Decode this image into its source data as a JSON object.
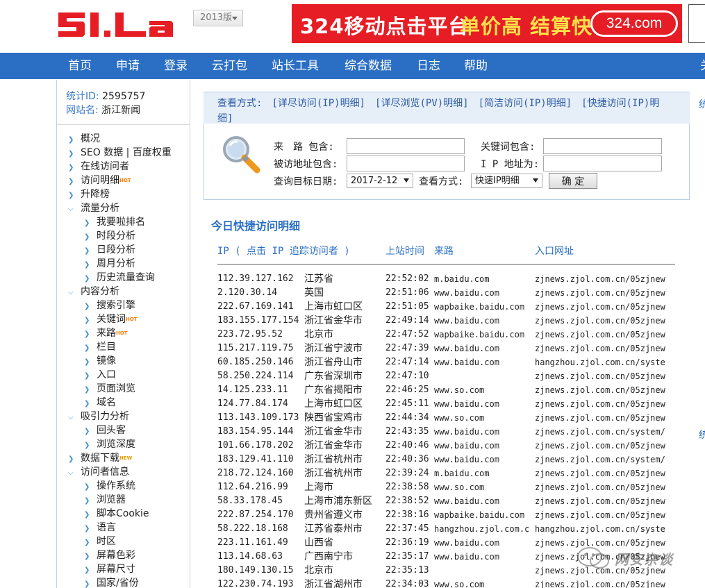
{
  "header": {
    "logo_text": "51.La",
    "version_label": "2013版",
    "ad": {
      "text_main": "324移动点击平台",
      "text_highlight": "单价高 结算快",
      "pill": "324.com"
    }
  },
  "nav": {
    "items": [
      "首页",
      "申请",
      "登录",
      "云打包",
      "站长工具",
      "综合数据",
      "日志",
      "帮助"
    ],
    "edge_fragment": "关"
  },
  "site_info": {
    "id_label": "统计ID:",
    "id_value": "2595757",
    "name_label": "网站名:",
    "name_value": "浙江新闻"
  },
  "sidebar": {
    "overview": "概况",
    "seo": "SEO 数据 | 百度权重",
    "online": "在线访问者",
    "visit_detail": "访问明细",
    "rank": "升降榜",
    "traffic": "流量分析",
    "traffic_children": [
      "我要啦排名",
      "时段分析",
      "日段分析",
      "周月分析",
      "历史流量查询"
    ],
    "content": "内容分析",
    "content_children": [
      "搜索引擎",
      "关键词",
      "来路",
      "栏目",
      "镜像",
      "入口",
      "页面浏览",
      "域名"
    ],
    "attract": "吸引力分析",
    "attract_children": [
      "回头客",
      "浏览深度"
    ],
    "download": "数据下载",
    "visitor": "访问者信息",
    "visitor_children": [
      "操作系统",
      "浏览器",
      "脚本Cookie",
      "语言",
      "时区",
      "屏幕色彩",
      "屏幕尺寸",
      "国家/省份"
    ],
    "badge_hot": "HOT",
    "badge_new": "NEW"
  },
  "viewbar": {
    "label": "查看方式:",
    "options": [
      "[详尽访问(IP)明细]",
      "[详尽浏览(PV)明细]",
      "[简洁访问(IP)明细]",
      "[快捷访问(IP)明细]"
    ]
  },
  "query": {
    "referrer_label": "来　路 包含:",
    "keyword_label": "关键词包含:",
    "visited_label": "被访地址包含:",
    "ip_label": "I P 地址为:",
    "date_label": "查询目标日期:",
    "date_value": "2017-2-12",
    "mode_label": "查看方式:",
    "mode_value": "快速IP明细",
    "confirm": "确 定"
  },
  "table": {
    "title": "今日快捷访问明细",
    "headers": {
      "ip": "IP ( 点击 IP 追踪访问者 )",
      "time": "上站时间",
      "referrer": "来路",
      "entry": "入口网址"
    },
    "rows": [
      {
        "ip": "112.39.127.162",
        "region": "江苏省",
        "time": "22:52:02",
        "referrer": "m.baidu.com",
        "entry": "zjnews.zjol.com.cn/05zjnew"
      },
      {
        "ip": "2.120.30.14",
        "region": "英国",
        "time": "22:51:06",
        "referrer": "www.baidu.com",
        "entry": "zjnews.zjol.com.cn/05zjnew"
      },
      {
        "ip": "222.67.169.141",
        "region": "上海市虹口区",
        "time": "22:51:05",
        "referrer": "wapbaike.baidu.com",
        "entry": "zjnews.zjol.com.cn/05zjnew"
      },
      {
        "ip": "183.155.177.154",
        "region": "浙江省金华市",
        "time": "22:49:14",
        "referrer": "www.baidu.com",
        "entry": "zjnews.zjol.com.cn/05zjnew"
      },
      {
        "ip": "223.72.95.52",
        "region": "北京市",
        "time": "22:47:52",
        "referrer": "wapbaike.baidu.com",
        "entry": "zjnews.zjol.com.cn/05zjnew"
      },
      {
        "ip": "115.217.119.75",
        "region": "浙江省宁波市",
        "time": "22:47:39",
        "referrer": "www.baidu.com",
        "entry": "zjnews.zjol.com.cn/05zjnew"
      },
      {
        "ip": "60.185.250.146",
        "region": "浙江省舟山市",
        "time": "22:47:14",
        "referrer": "www.baidu.com",
        "entry": "hangzhou.zjol.com.cn/syste"
      },
      {
        "ip": "58.250.224.114",
        "region": "广东省深圳市",
        "time": "22:47:10",
        "referrer": "",
        "entry": "zjnews.zjol.com.cn/05zjnew"
      },
      {
        "ip": "14.125.233.11",
        "region": "广东省揭阳市",
        "time": "22:46:25",
        "referrer": "www.so.com",
        "entry": "zjnews.zjol.com.cn/05zjnew"
      },
      {
        "ip": "124.77.84.174",
        "region": "上海市虹口区",
        "time": "22:45:11",
        "referrer": "www.baidu.com",
        "entry": "zjnews.zjol.com.cn/05zjnew"
      },
      {
        "ip": "113.143.109.173",
        "region": "陕西省宝鸡市",
        "time": "22:44:34",
        "referrer": "www.so.com",
        "entry": "zjnews.zjol.com.cn/05zjnew"
      },
      {
        "ip": "183.154.95.144",
        "region": "浙江省金华市",
        "time": "22:43:35",
        "referrer": "www.baidu.com",
        "entry": "zjnews.zjol.com.cn/system/"
      },
      {
        "ip": "101.66.178.202",
        "region": "浙江省金华市",
        "time": "22:40:46",
        "referrer": "www.baidu.com",
        "entry": "zjnews.zjol.com.cn/05zjnew"
      },
      {
        "ip": "183.129.41.110",
        "region": "浙江省杭州市",
        "time": "22:40:36",
        "referrer": "www.baidu.com",
        "entry": "zjnews.zjol.com.cn/system/"
      },
      {
        "ip": "218.72.124.160",
        "region": "浙江省杭州市",
        "time": "22:39:24",
        "referrer": "m.baidu.com",
        "entry": "zjnews.zjol.com.cn/05zjnew"
      },
      {
        "ip": "112.64.216.99",
        "region": "上海市",
        "time": "22:38:58",
        "referrer": "www.so.com",
        "entry": "zjnews.zjol.com.cn/05zjnew"
      },
      {
        "ip": "58.33.178.45",
        "region": "上海市浦东新区",
        "time": "22:38:52",
        "referrer": "www.baidu.com",
        "entry": "zjnews.zjol.com.cn/05zjnew"
      },
      {
        "ip": "222.87.254.170",
        "region": "贵州省遵义市",
        "time": "22:38:16",
        "referrer": "wapbaike.baidu.com",
        "entry": "zjnews.zjol.com.cn/05zjnew"
      },
      {
        "ip": "58.222.18.168",
        "region": "江苏省泰州市",
        "time": "22:37:45",
        "referrer": "hangzhou.zjol.com.c",
        "entry": "hangzhou.zjol.com.cn/syste"
      },
      {
        "ip": "223.11.161.49",
        "region": "山西省",
        "time": "22:36:19",
        "referrer": "www.baidu.com",
        "entry": "zjnews.zjol.com.cn/05zjnew"
      },
      {
        "ip": "113.14.68.63",
        "region": "广西南宁市",
        "time": "22:35:17",
        "referrer": "www.baidu.com",
        "entry": "zjnews.zjol.com.cn/05zjnew"
      },
      {
        "ip": "180.149.130.15",
        "region": "北京市",
        "time": "22:35:13",
        "referrer": "",
        "entry": "zjnews.zjol.com.cn/05zjnew"
      },
      {
        "ip": "122.230.74.193",
        "region": "浙江省湖州市",
        "time": "22:34:03",
        "referrer": "www.so.com",
        "entry": "zjnews.zjol.com.cn/05zjnew"
      }
    ]
  },
  "right_fragments": [
    "统",
    "统"
  ],
  "watermark": "网安杂谈",
  "colors": {
    "nav_blue": "#2b6fc4",
    "logo_red": "#e61d24",
    "ad_yellow": "#ffe24a",
    "link_blue": "#2b5aa7"
  }
}
